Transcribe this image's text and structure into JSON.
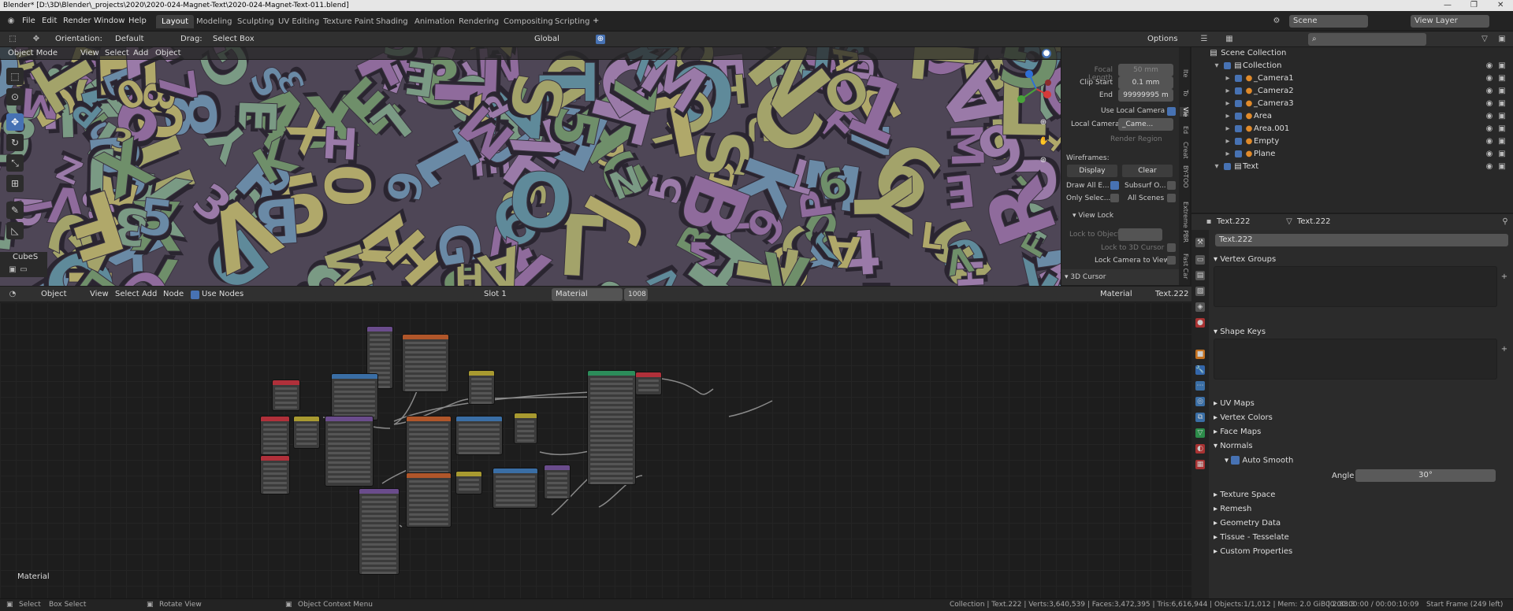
{
  "title": "Blender* [D:\\3D\\Blender\\_projects\\2020\\2020-024-Magnet-Text\\2020-024-Magnet-Text-011.blend]",
  "menu": [
    "File",
    "Edit",
    "Render",
    "Window",
    "Help"
  ],
  "workspaces": [
    "Layout",
    "Modeling",
    "Sculpting",
    "UV Editing",
    "Texture Paint",
    "Shading",
    "Animation",
    "Rendering",
    "Compositing",
    "Scripting"
  ],
  "topright": {
    "scene": "Scene",
    "view_layer": "View Layer"
  },
  "toolheader": {
    "orientation_label": "Orientation:",
    "orientation": "Default",
    "drag_label": "Drag:",
    "drag": "Select Box",
    "transform": "Global",
    "options": "Options"
  },
  "viewhdr": {
    "mode": "Object Mode",
    "view": "View",
    "select": "Select",
    "add": "Add",
    "object": "Object"
  },
  "viewport_label": "CubeS",
  "npanel": {
    "focal_length": "Focal Length",
    "focal_value": "50 mm",
    "clip_start": "Clip Start",
    "clip_start_value": "0.1 mm",
    "end": "End",
    "end_value": "99999995 m",
    "use_local_camera": "Use Local Camera",
    "local_camera": "Local Camera",
    "local_camera_value": "_Came...",
    "render_region": "Render Region",
    "wireframes": "Wireframes:",
    "display": "Display",
    "clear": "Clear",
    "draw_all": "Draw All E...",
    "subsurf": "Subsurf O...",
    "only_select": "Only Selec...",
    "all_scenes": "All Scenes",
    "view_lock": "View Lock",
    "lock_object": "Lock to Object",
    "lock_cursor": "Lock to 3D Cursor",
    "lock_camera": "Lock Camera to View",
    "cursor_3d": "3D Cursor"
  },
  "ntabs": [
    "Ite",
    "To",
    "Vie",
    "Ed",
    "Creat",
    "BY-TOO",
    "Extreme PBR",
    "Fast Car"
  ],
  "nodehdr": {
    "object": "Object",
    "view": "View",
    "select": "Select",
    "add": "Add",
    "node": "Node",
    "use_nodes": "Use Nodes",
    "slot": "Slot 1",
    "material": "Material",
    "users": "1008",
    "shader": "Material",
    "objname": "Text.222"
  },
  "node_label": "Material",
  "outliner": {
    "root": "Scene Collection",
    "items": [
      {
        "name": "Collection",
        "depth": 1
      },
      {
        "name": "_Camera1",
        "depth": 2
      },
      {
        "name": "_Camera2",
        "depth": 2
      },
      {
        "name": "_Camera3",
        "depth": 2
      },
      {
        "name": "Area",
        "depth": 2
      },
      {
        "name": "Area.001",
        "depth": 2
      },
      {
        "name": "Empty",
        "depth": 2
      },
      {
        "name": "Plane",
        "depth": 2
      },
      {
        "name": "Text",
        "depth": 1
      }
    ]
  },
  "props": {
    "obj": "Text.222",
    "data": "Text.222",
    "datafield": "Text.222",
    "sections": [
      "Vertex Groups",
      "Shape Keys",
      "UV Maps",
      "Vertex Colors",
      "Face Maps",
      "Normals",
      "Auto Smooth",
      "Angle",
      "Texture Space",
      "Remesh",
      "Geometry Data",
      "Tissue - Tesselate",
      "Custom Properties"
    ],
    "angle_value": "30°"
  },
  "status": {
    "select": "Select",
    "box": "Box Select",
    "rotate": "Rotate View",
    "context": "Object Context Menu",
    "stats": "Collection | Text.222 | Verts:3,640,539 | Faces:3,472,395 | Tris:6,616,944 | Objects:1/1,012 | Mem: 2.0 GiB | 2.83.3",
    "time": "00:00:00:00 / 00:00:10:09",
    "frame": "Start Frame (249 left)"
  }
}
